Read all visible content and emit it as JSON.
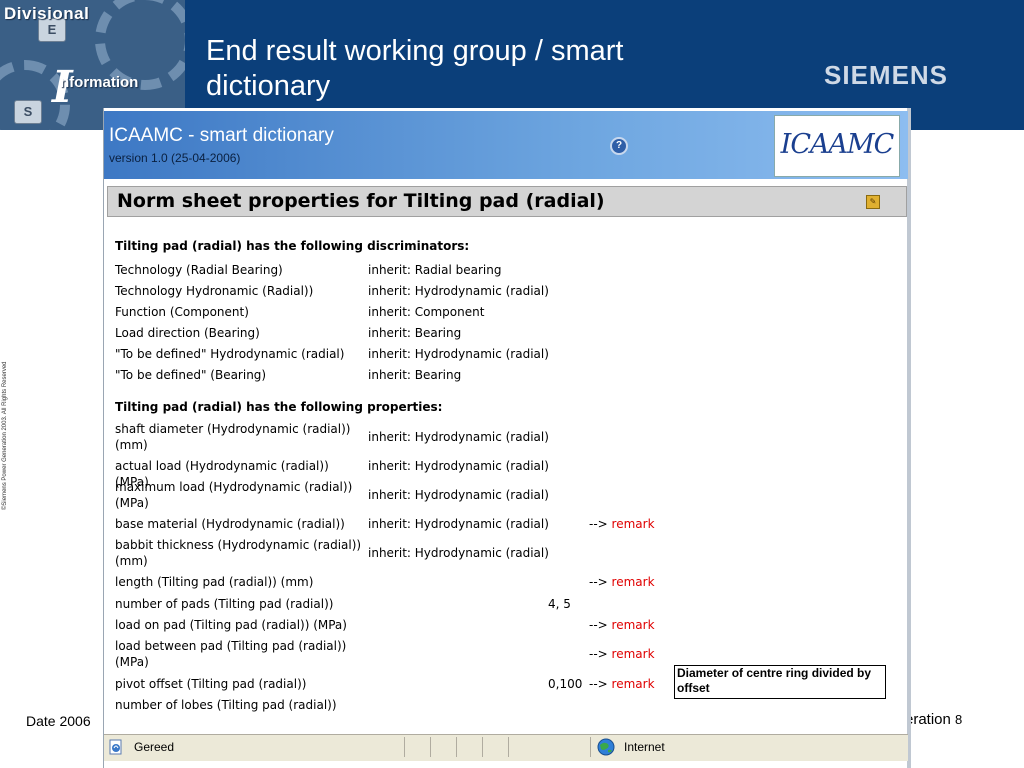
{
  "slide": {
    "title": "End result working group / smart dictionary",
    "brand": "SIEMENS",
    "logo": {
      "line1": "Divisional",
      "big_letter": "I",
      "line2": "nformation",
      "keys": [
        "E",
        "S"
      ]
    },
    "copyright": "©Siemens Power Generation 2003. All Rights Reserved",
    "footer_date": "Date 2006",
    "footer_right_label": "eration",
    "page_number": "8"
  },
  "app": {
    "title_main": "ICAAMC",
    "title_rest": " - smart dictionary",
    "version": "version 1.0 (25-04-2006)",
    "help_icon": "help-icon",
    "brand_logo_text": "ICAAMC"
  },
  "sheet": {
    "title": "Norm sheet properties for Tilting pad (radial)",
    "discriminators_heading": "Tilting pad (radial) has the following discriminators:",
    "discriminators": [
      {
        "name": "Technology (Radial Bearing)",
        "inherit": "inherit: Radial bearing"
      },
      {
        "name": "Technology Hydronamic (Radial))",
        "inherit": "inherit: Hydrodynamic (radial)"
      },
      {
        "name": "Function (Component)",
        "inherit": "inherit: Component"
      },
      {
        "name": "Load direction (Bearing)",
        "inherit": "inherit: Bearing"
      },
      {
        "name": "\"To be defined\" Hydrodynamic (radial)",
        "inherit": "inherit: Hydrodynamic (radial)"
      },
      {
        "name": "\"To be defined\" (Bearing)",
        "inherit": "inherit: Bearing"
      }
    ],
    "properties_heading": "Tilting pad (radial) has the following properties:",
    "properties": [
      {
        "name": "shaft diameter (Hydrodynamic (radial)) (mm)",
        "inherit": "inherit: Hydrodynamic (radial)",
        "value": "",
        "arrow": "",
        "remark": ""
      },
      {
        "name": "actual load (Hydrodynamic (radial)) (MPa)",
        "inherit": "inherit: Hydrodynamic (radial)",
        "value": "",
        "arrow": "",
        "remark": ""
      },
      {
        "name": "maximum load (Hydrodynamic (radial)) (MPa)",
        "inherit": "inherit: Hydrodynamic (radial)",
        "value": "",
        "arrow": "",
        "remark": ""
      },
      {
        "name": "base material (Hydrodynamic (radial))",
        "inherit": "inherit: Hydrodynamic (radial)",
        "value": "",
        "arrow": "-->",
        "remark": "remark"
      },
      {
        "name": "babbit thickness (Hydrodynamic (radial)) (mm)",
        "inherit": "inherit: Hydrodynamic (radial)",
        "value": "",
        "arrow": "",
        "remark": ""
      },
      {
        "name": "length (Tilting pad (radial)) (mm)",
        "inherit": "",
        "value": "",
        "arrow": "-->",
        "remark": "remark"
      },
      {
        "name": "number of pads (Tilting pad (radial))",
        "inherit": "",
        "value": "4, 5",
        "arrow": "",
        "remark": ""
      },
      {
        "name": "load on pad (Tilting pad (radial)) (MPa)",
        "inherit": "",
        "value": "",
        "arrow": "-->",
        "remark": "remark"
      },
      {
        "name": "load between pad (Tilting pad (radial)) (MPa)",
        "inherit": "",
        "value": "",
        "arrow": "-->",
        "remark": "remark"
      },
      {
        "name": "pivot offset (Tilting pad (radial))",
        "inherit": "",
        "value": "0,100",
        "arrow": "-->",
        "remark": "remark"
      },
      {
        "name": "number of lobes (Tilting pad (radial))",
        "inherit": "",
        "value": "",
        "arrow": "",
        "remark": ""
      }
    ],
    "callout": "Diameter of centre ring divided by offset"
  },
  "statusbar": {
    "status": "Gereed",
    "zone": "Internet"
  },
  "colors": {
    "header_bg": "#0b3f7a",
    "remark": "#e00000",
    "app_gradient_start": "#3d78c4",
    "app_gradient_end": "#8dbdf0"
  }
}
